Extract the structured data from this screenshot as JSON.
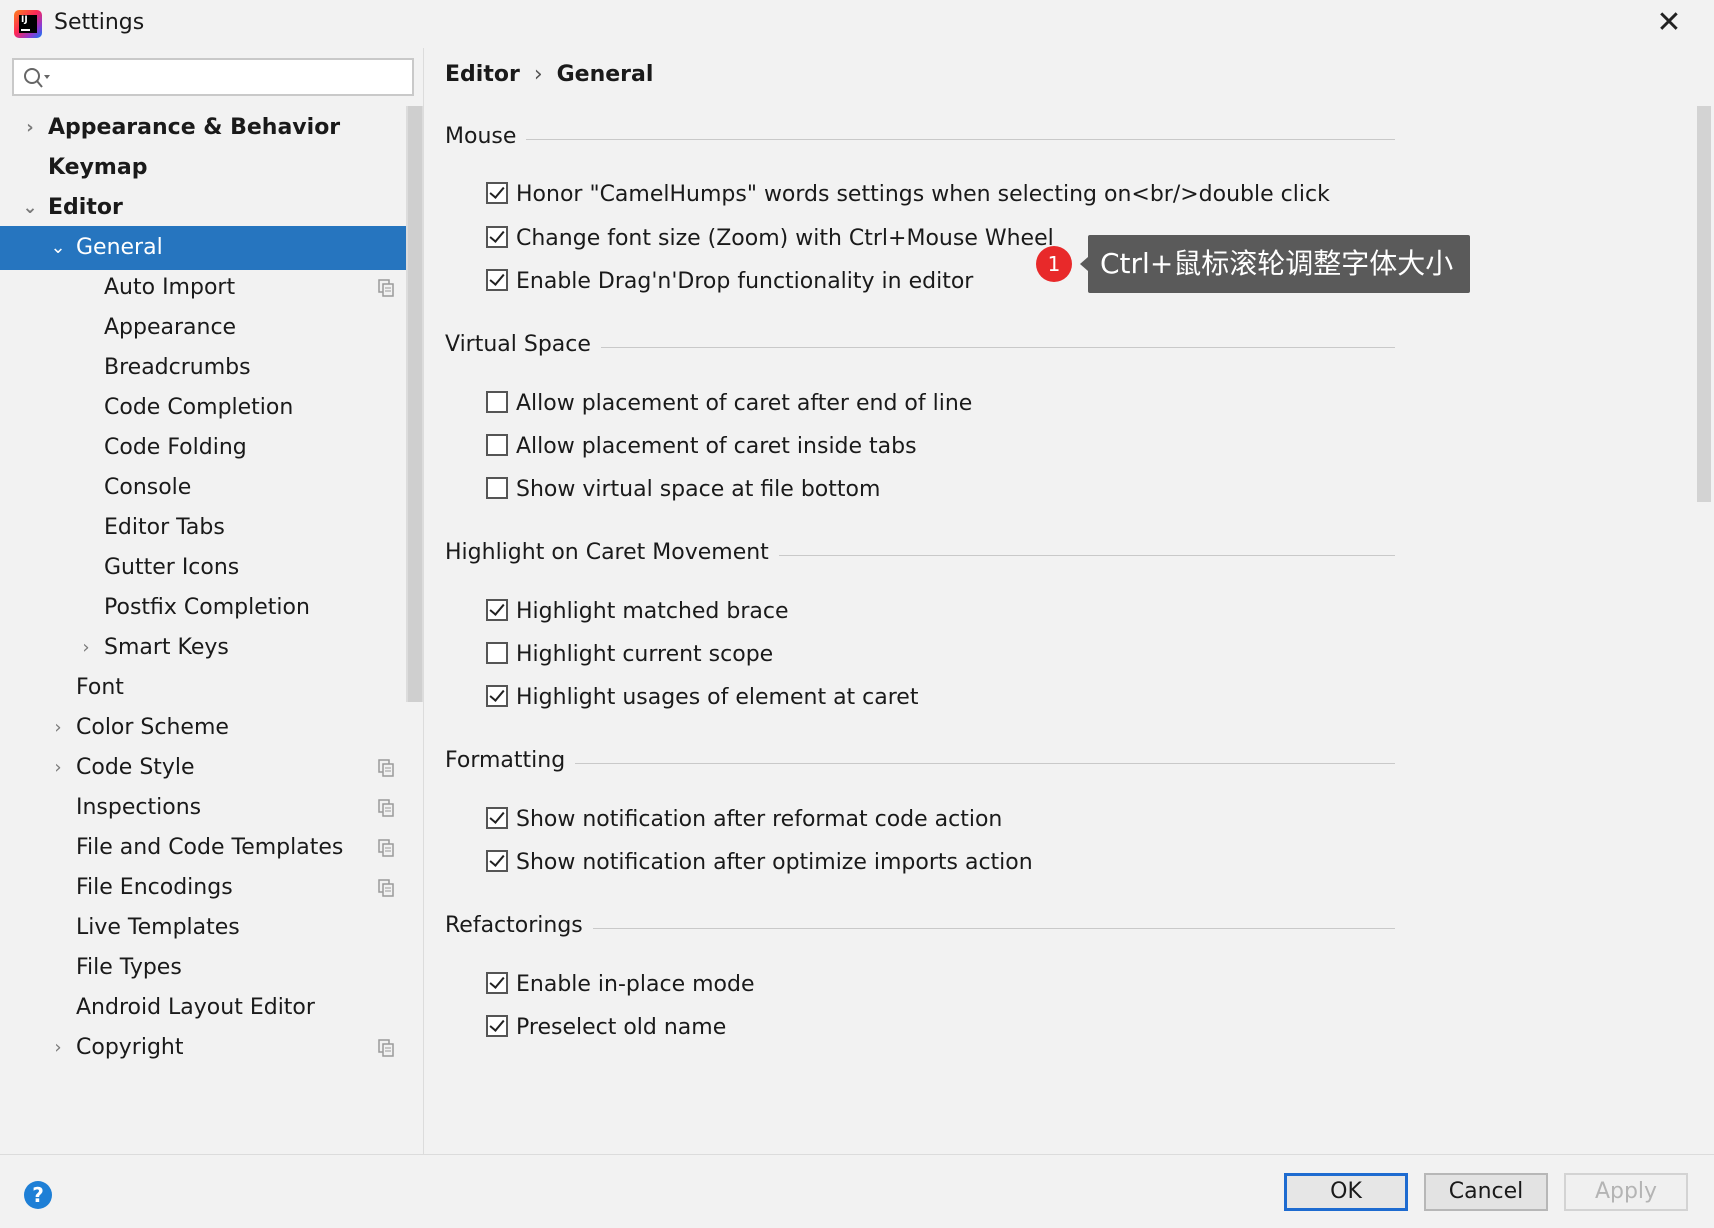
{
  "window": {
    "title": "Settings",
    "close_label": "✕"
  },
  "search": {
    "placeholder": "",
    "value": ""
  },
  "sidebar": {
    "items": [
      {
        "label": "Appearance & Behavior",
        "level": 0,
        "arrow": "›",
        "bold": true,
        "selected": false,
        "copy": false
      },
      {
        "label": "Keymap",
        "level": 0,
        "arrow": "",
        "bold": true,
        "selected": false,
        "copy": false
      },
      {
        "label": "Editor",
        "level": 0,
        "arrow": "⌄",
        "bold": true,
        "selected": false,
        "copy": false
      },
      {
        "label": "General",
        "level": 1,
        "arrow": "⌄",
        "bold": false,
        "selected": true,
        "copy": false
      },
      {
        "label": "Auto Import",
        "level": 2,
        "arrow": "",
        "bold": false,
        "selected": false,
        "copy": true
      },
      {
        "label": "Appearance",
        "level": 2,
        "arrow": "",
        "bold": false,
        "selected": false,
        "copy": false
      },
      {
        "label": "Breadcrumbs",
        "level": 2,
        "arrow": "",
        "bold": false,
        "selected": false,
        "copy": false
      },
      {
        "label": "Code Completion",
        "level": 2,
        "arrow": "",
        "bold": false,
        "selected": false,
        "copy": false
      },
      {
        "label": "Code Folding",
        "level": 2,
        "arrow": "",
        "bold": false,
        "selected": false,
        "copy": false
      },
      {
        "label": "Console",
        "level": 2,
        "arrow": "",
        "bold": false,
        "selected": false,
        "copy": false
      },
      {
        "label": "Editor Tabs",
        "level": 2,
        "arrow": "",
        "bold": false,
        "selected": false,
        "copy": false
      },
      {
        "label": "Gutter Icons",
        "level": 2,
        "arrow": "",
        "bold": false,
        "selected": false,
        "copy": false
      },
      {
        "label": "Postfix Completion",
        "level": 2,
        "arrow": "",
        "bold": false,
        "selected": false,
        "copy": false
      },
      {
        "label": "Smart Keys",
        "level": 2,
        "arrow": "›",
        "bold": false,
        "selected": false,
        "copy": false
      },
      {
        "label": "Font",
        "level": 1,
        "arrow": "",
        "bold": false,
        "selected": false,
        "copy": false
      },
      {
        "label": "Color Scheme",
        "level": 1,
        "arrow": "›",
        "bold": false,
        "selected": false,
        "copy": false
      },
      {
        "label": "Code Style",
        "level": 1,
        "arrow": "›",
        "bold": false,
        "selected": false,
        "copy": true
      },
      {
        "label": "Inspections",
        "level": 1,
        "arrow": "",
        "bold": false,
        "selected": false,
        "copy": true
      },
      {
        "label": "File and Code Templates",
        "level": 1,
        "arrow": "",
        "bold": false,
        "selected": false,
        "copy": true
      },
      {
        "label": "File Encodings",
        "level": 1,
        "arrow": "",
        "bold": false,
        "selected": false,
        "copy": true
      },
      {
        "label": "Live Templates",
        "level": 1,
        "arrow": "",
        "bold": false,
        "selected": false,
        "copy": false
      },
      {
        "label": "File Types",
        "level": 1,
        "arrow": "",
        "bold": false,
        "selected": false,
        "copy": false
      },
      {
        "label": "Android Layout Editor",
        "level": 1,
        "arrow": "",
        "bold": false,
        "selected": false,
        "copy": false
      },
      {
        "label": "Copyright",
        "level": 1,
        "arrow": "›",
        "bold": false,
        "selected": false,
        "copy": true
      }
    ]
  },
  "breadcrumb": {
    "parent": "Editor",
    "separator": "›",
    "current": "General"
  },
  "sections": {
    "mouse": "Mouse",
    "virtual_space": "Virtual Space",
    "highlight": "Highlight on Caret Movement",
    "formatting": "Formatting",
    "refactorings": "Refactorings"
  },
  "options": {
    "camel_humps": {
      "label": "Honor \"CamelHumps\" words settings when selecting on<br/>double click",
      "checked": true
    },
    "zoom": {
      "label": "Change font size (Zoom) with Ctrl+Mouse Wheel",
      "checked": true
    },
    "drag_drop": {
      "label": "Enable Drag'n'Drop functionality in editor",
      "checked": true
    },
    "caret_eol": {
      "label": "Allow placement of caret after end of line",
      "checked": false
    },
    "caret_tabs": {
      "label": "Allow placement of caret inside tabs",
      "checked": false
    },
    "virtual_bottom": {
      "label": "Show virtual space at file bottom",
      "checked": false
    },
    "matched_brace": {
      "label": "Highlight matched brace",
      "checked": true
    },
    "current_scope": {
      "label": "Highlight current scope",
      "checked": false
    },
    "usages_caret": {
      "label": "Highlight usages of element at caret",
      "checked": true
    },
    "notify_reformat": {
      "label": "Show notification after reformat code action",
      "checked": true
    },
    "notify_imports": {
      "label": "Show notification after optimize imports action",
      "checked": true
    },
    "inplace_mode": {
      "label": "Enable in-place mode",
      "checked": true
    },
    "preselect_name": {
      "label": "Preselect old name",
      "checked": true
    }
  },
  "annotation": {
    "number": "1",
    "text": "Ctrl+鼠标滚轮调整字体大小"
  },
  "buttons": {
    "help": "?",
    "ok": "OK",
    "cancel": "Cancel",
    "apply": "Apply"
  },
  "colors": {
    "selection": "#2675bf",
    "badge": "#e8292a",
    "tooltip_bg": "#5a5a5a",
    "ok_border": "#1e6bd0"
  }
}
